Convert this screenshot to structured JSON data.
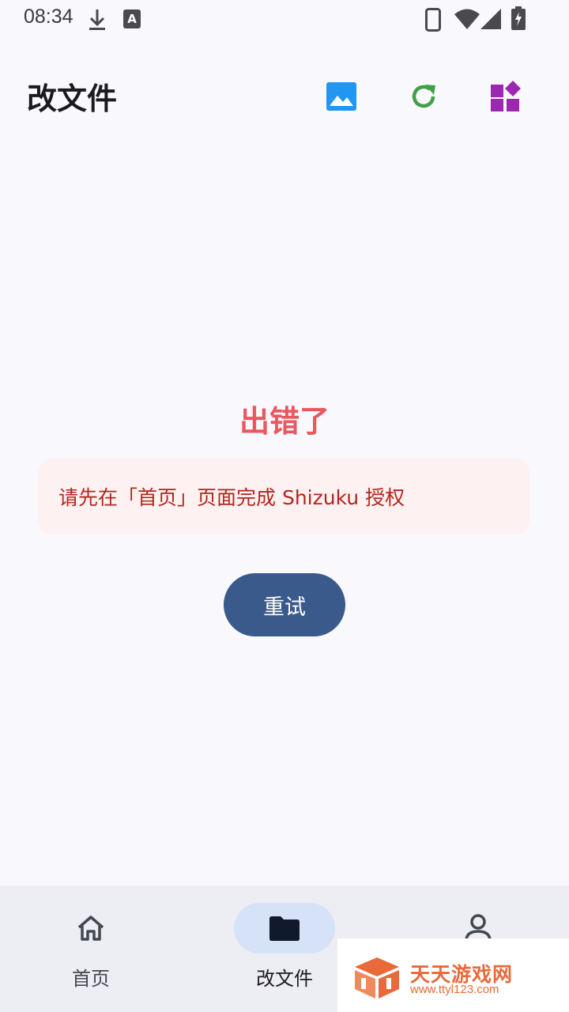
{
  "status_bar": {
    "time": "08:34",
    "icons": [
      "download-icon",
      "keyboard-a-icon",
      "phone-icon",
      "wifi-icon",
      "signal-icon",
      "battery-charging-icon"
    ]
  },
  "app_bar": {
    "title": "改文件",
    "actions": [
      {
        "icon": "image-icon",
        "color": "#2196f3"
      },
      {
        "icon": "refresh-icon",
        "color": "#43a047"
      },
      {
        "icon": "widgets-icon",
        "color": "#9c27b0"
      }
    ]
  },
  "error": {
    "title": "出错了",
    "message": "请先在「首页」页面完成 Shizuku 授权",
    "title_color": "#e9585f",
    "message_color": "#b3261e",
    "card_color": "#fdf1f1"
  },
  "retry_button": {
    "label": "重试",
    "color": "#3a5a8c"
  },
  "bottom_nav": {
    "items": [
      {
        "label": "首页",
        "icon": "home-icon",
        "active": false
      },
      {
        "label": "改文件",
        "icon": "folder-icon",
        "active": true
      },
      {
        "label": "",
        "icon": "person-icon",
        "active": false
      }
    ]
  },
  "watermark": {
    "title": "天天游戏网",
    "url": "www.ttyl123.com",
    "color": "#e8693a"
  }
}
